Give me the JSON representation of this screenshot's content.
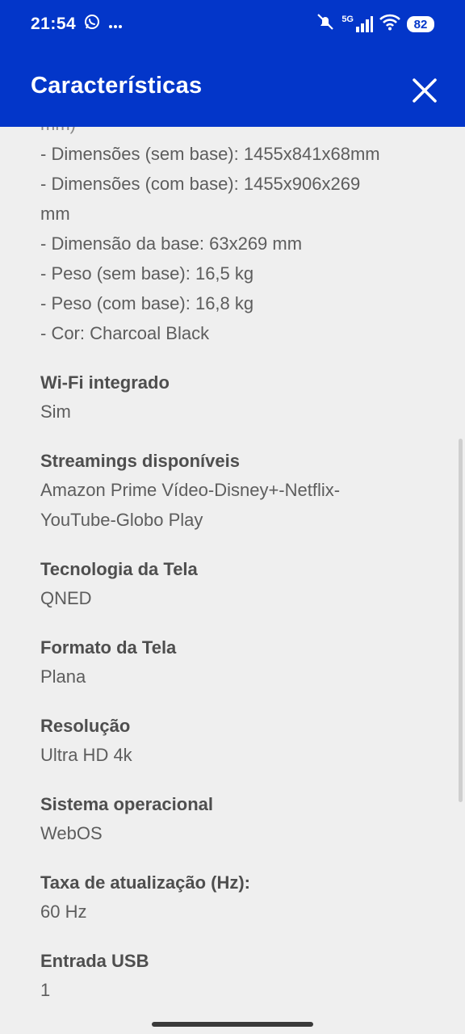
{
  "status_bar": {
    "time": "21:54",
    "notification_icons": [
      "whatsapp-icon",
      "more-dots-icon"
    ],
    "system_icons": [
      "mute-icon",
      "5g-signal-icon",
      "wifi-icon"
    ],
    "network_label": "5G",
    "battery": "82"
  },
  "header": {
    "title": "Características",
    "close_icon": "close-icon",
    "bg_color": "#0336c9"
  },
  "dimensions": {
    "cut_line": "mm)",
    "lines": [
      "- Dimensões (sem base): 1455x841x68mm",
      "- Dimensões (com base): 1455x906x269",
      "mm",
      "- Dimensão da base: 63x269 mm",
      "- Peso (sem base): 16,5 kg",
      "- Peso (com base): 16,8 kg",
      "- Cor: Charcoal Black"
    ]
  },
  "specs": [
    {
      "label": "Wi-Fi integrado",
      "value": "Sim"
    },
    {
      "label": "Streamings disponíveis",
      "value": "Amazon Prime Vídeo-Disney+-Netflix-",
      "value2": "YouTube-Globo Play"
    },
    {
      "label": "Tecnologia da Tela",
      "value": "QNED"
    },
    {
      "label": "Formato da Tela",
      "value": "Plana"
    },
    {
      "label": "Resolução",
      "value": "Ultra HD 4k"
    },
    {
      "label": "Sistema operacional",
      "value": "WebOS"
    },
    {
      "label": "Taxa de atualização (Hz):",
      "value": "60 Hz"
    },
    {
      "label": "Entrada USB",
      "value": "1"
    }
  ]
}
